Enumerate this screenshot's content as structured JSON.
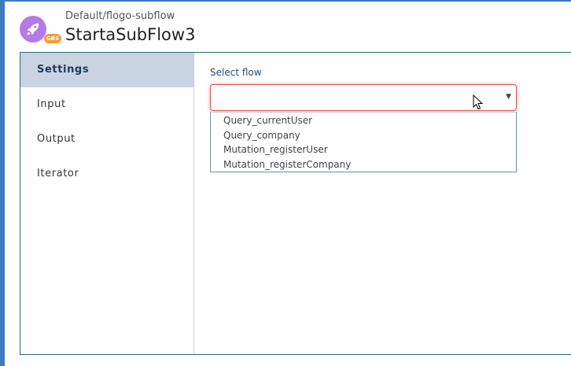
{
  "header": {
    "breadcrumb": "Default/flogo-subflow",
    "title": "StartaSubFlow3",
    "badge": "GBS",
    "icon": "rocket-icon",
    "icon_color": "#b27be8",
    "badge_color": "#f29b3a"
  },
  "sidebar": {
    "items": [
      {
        "label": "Settings",
        "active": true
      },
      {
        "label": "Input",
        "active": false
      },
      {
        "label": "Output",
        "active": false
      },
      {
        "label": "Iterator",
        "active": false
      }
    ]
  },
  "settings": {
    "select_label": "Select flow",
    "select_value": "",
    "options": [
      "Query_currentUser",
      "Query_company",
      "Mutation_registerUser",
      "Mutation_registerCompany"
    ]
  },
  "colors": {
    "accent": "#3f7cbf",
    "active_tab_bg": "#c9d3e2",
    "error_border": "#d9534f",
    "panel_border": "#2b6e78"
  }
}
